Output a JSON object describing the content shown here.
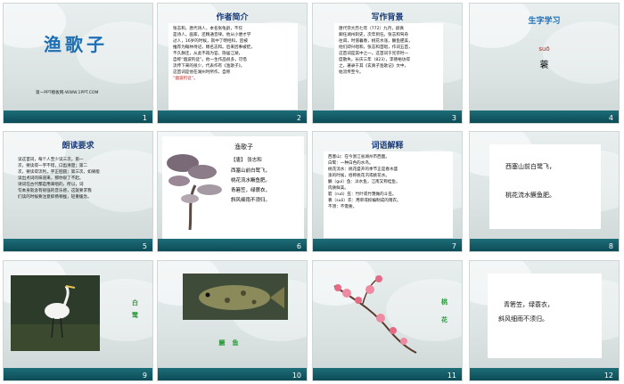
{
  "slides": [
    {
      "num": "1",
      "title": "渔歌子",
      "footer": "第一PPT模板网-WWW.1PPT.COM"
    },
    {
      "num": "2",
      "title": "作者简介",
      "lines": [
        "张志和，唐代诗人，本名张龟龄，不仅",
        "是诗人，画家，还精通音律。他从小便才学",
        "过人，16岁的时候，就中了明经科，后被",
        "推荐为翰林待诏，赐名志和。后来因事被贬，",
        "不久赦还，从此不再为官，隐居江湖，",
        "自称“烟波钓徒”。他一生作品很多，可惜",
        "流传下来的很少，代表作有《渔歌子》。",
        "这首词是他在湖州时所作，自称",
        "“烟波钓徒”。"
      ]
    },
    {
      "num": "3",
      "title": "写作背景",
      "lines": [
        "唐代宗大历七年（772）九月，颜真",
        "卿任湖州刺史，次年到任。张志和驾舟",
        "往谒，时值暮春，桃花水涨，鳜鱼肥美，",
        "他们即兴唱和，张志和首唱，作词五首，",
        "这首词是其中之一。这首词于宪宗时一",
        "度散失，长庆三年（823），李德裕访得",
        "之。著录于其《玄真子渔歌记》文中，",
        "始流传至今。"
      ]
    },
    {
      "num": "4",
      "title": "生字学习",
      "pinyin": "suō",
      "char": "蓑"
    },
    {
      "num": "5",
      "title": "朗读要求",
      "lines": [
        "读这首词，每个人至少读三次。第一",
        "次，要读得一字不错，口齿清楚；第二",
        "次，要读得流利，字正腔圆；第三次，如果能",
        "读出点词的味道来，那你很了不起。",
        "诗词在古代都是用来唱的，所以，词",
        "句本身就含有很强的音乐感，这就要求我",
        "们读的时候要注意抑扬顿挫，轻重缓急。"
      ]
    },
    {
      "num": "6",
      "title": "渔歌子",
      "author": "【唐】 张志和",
      "lines": [
        "西塞山前白鹭飞，",
        "桃花流水鳜鱼肥。",
        "青箬笠，绿蓑衣，",
        "斜风细雨不须归。"
      ]
    },
    {
      "num": "7",
      "title": "词语解释",
      "lines": [
        "西塞山：在今浙江省湖州市西面。",
        "白鹭：一种白色的水鸟。",
        "桃花流水：桃花盛开的季节正是春水盛",
        "涨的时候，俗称桃花汛或桃花水。",
        "鳜（guì）鱼：淡水鱼，江南又称桂鱼，",
        "肉质鲜美。",
        "箬（ruò）笠：竹叶或竹篾做的斗笠。",
        "蓑（suō）衣：用草或棕编制成的雨衣。",
        "不须：不需要。"
      ]
    },
    {
      "num": "8",
      "lines": [
        "西塞山前白鹭飞，",
        "桃花流水鳜鱼肥。"
      ]
    },
    {
      "num": "9",
      "label": "白鹭"
    },
    {
      "num": "10",
      "label": "鳜鱼"
    },
    {
      "num": "11",
      "label": "桃花"
    },
    {
      "num": "12",
      "lines": [
        "青箬笠，绿蓑衣，",
        "斜风细雨不须归。"
      ]
    }
  ]
}
